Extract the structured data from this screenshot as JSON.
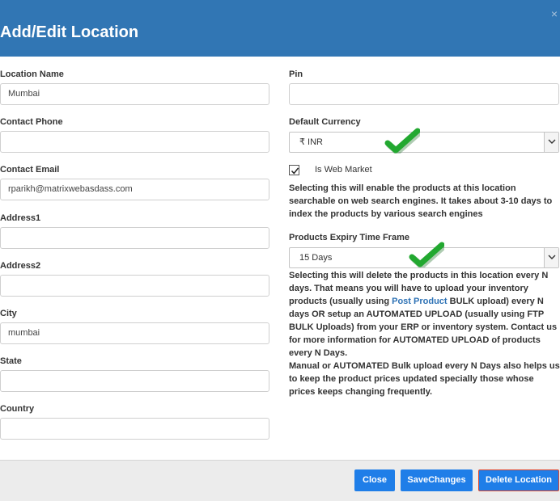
{
  "dialog": {
    "title": "Add/Edit Location",
    "close_glyph": "×"
  },
  "form": {
    "location_name": {
      "label": "Location Name",
      "value": "Mumbai"
    },
    "contact_phone": {
      "label": "Contact Phone",
      "value": ""
    },
    "contact_email": {
      "label": "Contact Email",
      "value": "rparikh@matrixwebasdass.com"
    },
    "address1": {
      "label": "Address1",
      "value": ""
    },
    "address2": {
      "label": "Address2",
      "value": ""
    },
    "city": {
      "label": "City",
      "value": "mumbai"
    },
    "state": {
      "label": "State",
      "value": ""
    },
    "country": {
      "label": "Country",
      "value": ""
    },
    "pin": {
      "label": "Pin",
      "value": ""
    },
    "default_currency": {
      "label": "Default Currency",
      "value": "₹ INR"
    },
    "web_market": {
      "label": "Is Web Market",
      "checked": true
    },
    "web_market_help": "Selecting this will enable the products at this location searchable on web search engines. It takes about 3-10 days to index the products by various search engines",
    "expiry": {
      "label": "Products Expiry Time Frame",
      "value": "15 Days"
    },
    "expiry_help": {
      "part1": "Selecting this will delete the products in this location every N days. That means you will have to upload your inventory products (usually using ",
      "link": "Post Product",
      "part2": " BULK upload) every N days OR setup an AUTOMATED UPLOAD (usually using FTP BULK Uploads) from your ERP or inventory system. Contact us for more information for AUTOMATED UPLOAD of products every N Days."
    },
    "bulk_help": "Manual or AUTOMATED Bulk upload every N Days also helps us to keep the product prices updated specially those whose prices keeps changing frequently."
  },
  "footer": {
    "close_label": "Close",
    "save_label": "SaveChanges",
    "delete_label": "Delete Location"
  },
  "colors": {
    "header": "#3176b4",
    "button": "#1f7ee8",
    "danger_border": "#e2452a",
    "link": "#2e72b5",
    "checkmark": "#22a830"
  }
}
